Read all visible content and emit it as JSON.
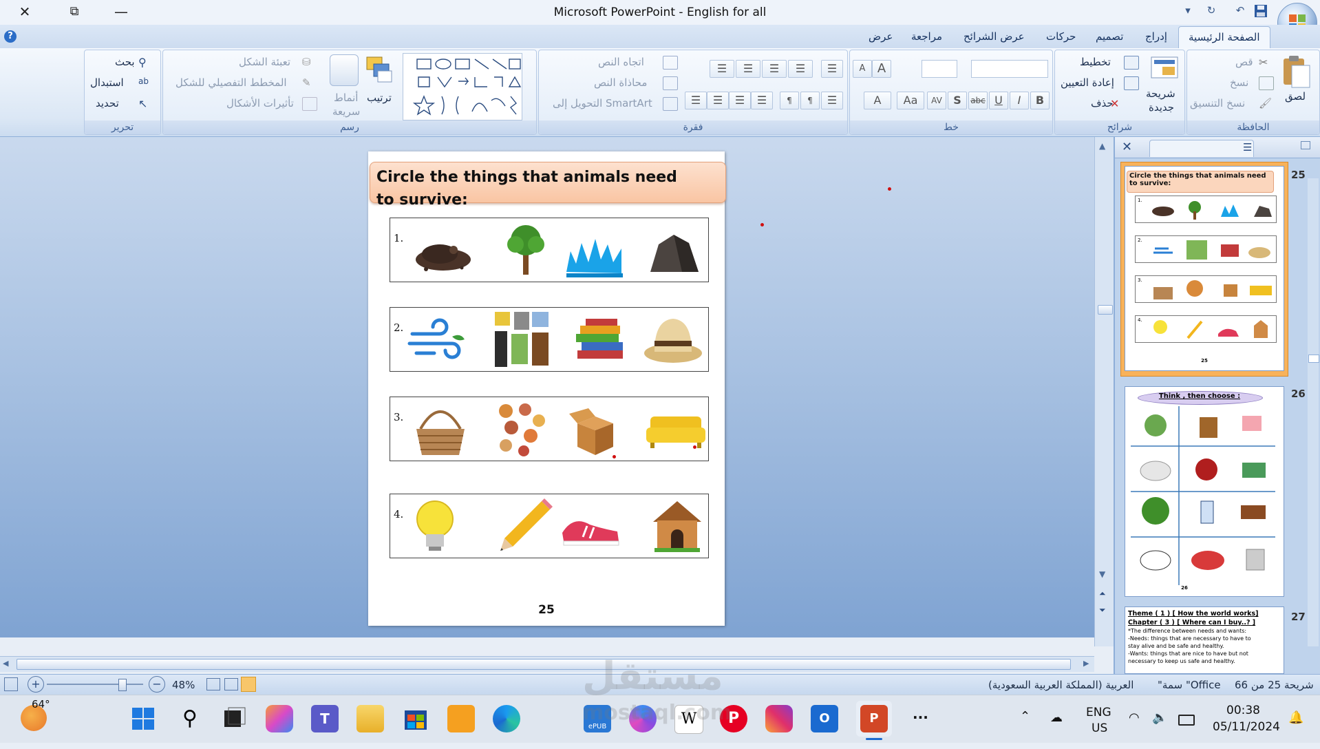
{
  "window": {
    "title": "Microsoft PowerPoint - English for all",
    "close_glyph": "✕",
    "restore_glyph": "⧉",
    "minimize_glyph": "—"
  },
  "ribbon_tabs": [
    "الصفحة الرئيسية",
    "إدراج",
    "تصميم",
    "حركات",
    "عرض الشرائح",
    "مراجعة",
    "عرض"
  ],
  "ribbon": {
    "clipboard": {
      "paste": "لصق",
      "cut": "قص",
      "copy": "نسخ",
      "format_painter": "نسخ التنسيق",
      "label": "الحافظة"
    },
    "slides": {
      "new_slide_1": "شريحة",
      "new_slide_2": "جديدة",
      "layout": "تخطيط",
      "reset": "إعادة التعيين",
      "delete": "حذف",
      "label": "شرائح"
    },
    "font": {
      "bold": "B",
      "italic": "I",
      "underline": "U",
      "strike": "abc",
      "shadow": "S",
      "spacing": "AV",
      "case": "Aa",
      "grow": "A",
      "shrink": "A",
      "color": "A",
      "label": "خط"
    },
    "paragraph": {
      "text_direction": "اتجاه النص",
      "align_text": "محاذاة النص",
      "smartart": "التحويل إلى SmartArt",
      "label": "فقرة"
    },
    "drawing": {
      "arrange": "ترتيب",
      "quick_styles_1": "أنماط",
      "quick_styles_2": "سريعة",
      "shape_fill": "تعبئة الشكل",
      "shape_outline": "المخطط التفصيلي للشكل",
      "shape_effects": "تأثيرات الأشكال",
      "label": "رسم"
    },
    "editing": {
      "find": "بحث",
      "replace": "استبدال",
      "select": "تحديد",
      "label": "تحرير"
    }
  },
  "slide": {
    "title": "Circle the things that animals need to survive:",
    "rows": [
      {
        "number": "1.",
        "items": [
          "soil",
          "tree",
          "water",
          "rock"
        ]
      },
      {
        "number": "2.",
        "items": [
          "wind",
          "clothes",
          "books",
          "hat"
        ]
      },
      {
        "number": "3.",
        "items": [
          "basket",
          "food",
          "box",
          "sofa"
        ]
      },
      {
        "number": "4.",
        "items": [
          "light-bulb",
          "pencil",
          "shoes",
          "doghouse"
        ]
      }
    ],
    "page_number": "25"
  },
  "slides_pane": {
    "thumb25": {
      "number": "25",
      "title": "Circle the things that animals need to survive:",
      "page": "25",
      "rownums": [
        "1.",
        "2.",
        "3.",
        "4."
      ]
    },
    "thumb26": {
      "number": "26",
      "title": "Think , then choose :",
      "page": "26"
    },
    "thumb27": {
      "number": "27",
      "line1": "Theme ( 1 ) [ How the world works]",
      "line2": "Chapter ( 3 ) [ Where can I buy..? ]",
      "line3": "*The difference between needs and wants:",
      "line4": "-Needs: things that are necessary to have to",
      "line5": "stay alive and be safe and healthy.",
      "line6": "-Wants: things that are nice to have but not",
      "line7": "necessary to keep us safe and healthy."
    }
  },
  "statusbar": {
    "slide_info": "شريحة 25 من 66",
    "theme": "\"سمة \"Office",
    "language": "العربية (المملكة العربية السعودية)",
    "zoom": "48%"
  },
  "taskbar": {
    "weather": "64°",
    "lang1": "ENG",
    "lang2": "US",
    "time": "00:38",
    "date": "05/11/2024",
    "more": "···"
  },
  "watermark": {
    "arabic": "مستقل",
    "latin": "mostaql.com"
  }
}
